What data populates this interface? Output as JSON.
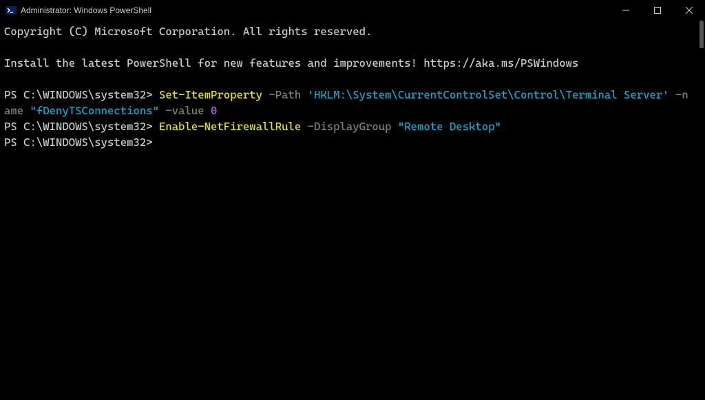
{
  "window": {
    "title": "Administrator: Windows PowerShell"
  },
  "terminal": {
    "copyright": "Copyright (C) Microsoft Corporation. All rights reserved.",
    "installMsg": "Install the latest PowerShell for new features and improvements! https://aka.ms/PSWindows",
    "prompt": "PS C:\\WINDOWS\\system32>",
    "line1": {
      "cmd": "Set-ItemProperty",
      "paramPath": "-Path",
      "valPath": "'HKLM:\\System\\CurrentControlSet\\Control\\Terminal Server'",
      "paramName": "-name",
      "valName": "\"fDenyTSConnections\"",
      "paramValue": "-value",
      "valValue": "0"
    },
    "line2": {
      "cmd": "Enable-NetFirewallRule",
      "paramDisplayGroup": "-DisplayGroup",
      "valDisplayGroup": "\"Remote Desktop\""
    }
  }
}
